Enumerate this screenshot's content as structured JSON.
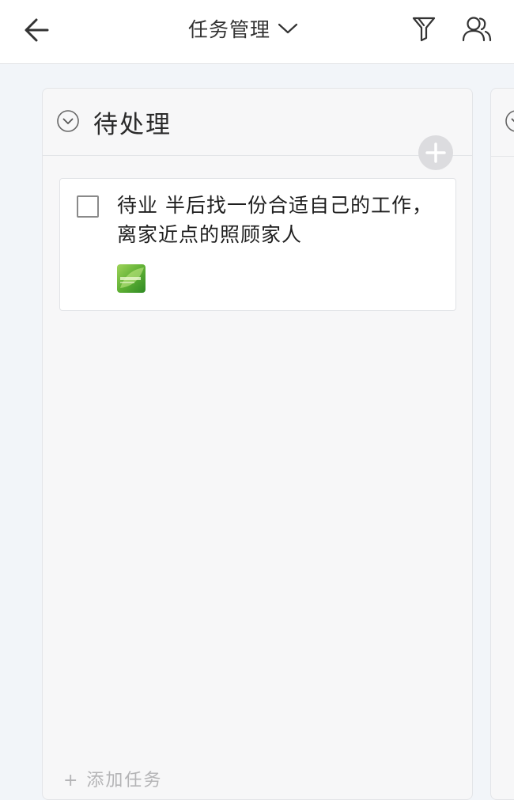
{
  "header": {
    "title": "任务管理",
    "icons": {
      "back": "arrow-left-icon",
      "title_dropdown": "chevron-down-icon",
      "filter": "filter-icon",
      "members": "members-icon"
    }
  },
  "column": {
    "title": "待处理",
    "collapse_icon": "chevron-down-circle-icon",
    "add_icon": "plus-icon",
    "cards": [
      {
        "text": "待业 半后找一份合适自己的工作，离家近点的照顾家人",
        "checked": false,
        "thumbnail": "green-leaf-image"
      }
    ]
  },
  "footer": {
    "hint": "+ 添加任务"
  },
  "colors": {
    "background": "#f2f5f9",
    "column": "#f7f7f8",
    "card": "#ffffff",
    "add_button": "#dcdcdf",
    "border": "#e3e5e8"
  }
}
